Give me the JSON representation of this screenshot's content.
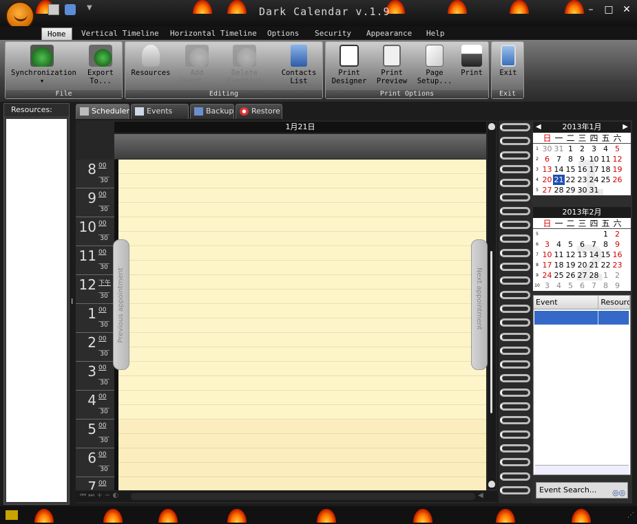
{
  "app": {
    "title": "Dark Calendar v.1.9",
    "window_buttons": {
      "minimize": "–",
      "maximize": "□",
      "close": "✕"
    }
  },
  "menu": {
    "tabs": [
      "Home",
      "Vertical Timeline",
      "Horizontal Timeline",
      "Options",
      "Security",
      "Appearance",
      "Help"
    ],
    "active": "Home"
  },
  "ribbon": {
    "groups": {
      "file": {
        "label": "File",
        "buttons": [
          {
            "label": "Synchronization",
            "icon": "sync-icon",
            "dropdown": true
          },
          {
            "label": "Export\nTo...",
            "icon": "export-icon",
            "dropdown": true
          }
        ]
      },
      "editing": {
        "label": "Editing",
        "buttons": [
          {
            "label": "Resources",
            "icon": "resources-icon"
          },
          {
            "label": "Add\nEvent...",
            "icon": "add-event-icon",
            "disabled": true
          },
          {
            "label": "Delete\nEvent(s)",
            "icon": "delete-event-icon",
            "disabled": true,
            "dropdown": true
          },
          {
            "label": "Contacts\nList",
            "icon": "contacts-icon"
          }
        ]
      },
      "print": {
        "label": "Print Options",
        "buttons": [
          {
            "label": "Print\nDesigner",
            "icon": "print-designer-icon"
          },
          {
            "label": "Print\nPreview",
            "icon": "print-preview-icon"
          },
          {
            "label": "Page\nSetup...",
            "icon": "page-setup-icon"
          },
          {
            "label": "Print",
            "icon": "printer-icon"
          }
        ]
      },
      "exit": {
        "label": "Exit",
        "buttons": [
          {
            "label": "Exit",
            "icon": "exit-door-icon"
          }
        ]
      }
    }
  },
  "resources_panel": {
    "title": "Resources:"
  },
  "main_tabs": [
    {
      "label": "Scheduler",
      "icon": "scheduler-icon",
      "active": true
    },
    {
      "label": "Events List",
      "icon": "events-list-icon"
    },
    {
      "label": "Backup",
      "icon": "backup-icon"
    },
    {
      "label": "Restore",
      "icon": "restore-icon"
    }
  ],
  "scheduler": {
    "date_header": "1月21日",
    "hours": [
      {
        "h": "8",
        "m": "00"
      },
      {
        "h": "9",
        "m": "00"
      },
      {
        "h": "10",
        "m": "00"
      },
      {
        "h": "11",
        "m": "00"
      },
      {
        "h": "12",
        "m": "下午"
      },
      {
        "h": "1",
        "m": "00"
      },
      {
        "h": "2",
        "m": "00"
      },
      {
        "h": "3",
        "m": "00"
      },
      {
        "h": "4",
        "m": "00"
      },
      {
        "h": "5",
        "m": "00"
      },
      {
        "h": "6",
        "m": "00"
      },
      {
        "h": "7",
        "m": "00"
      }
    ],
    "half": "30",
    "prev_label": "Previous appointment",
    "next_label": "Next appointment"
  },
  "calendar": {
    "weekdays": [
      "日",
      "一",
      "二",
      "三",
      "四",
      "五",
      "六"
    ],
    "months": [
      {
        "title": "2013年1月",
        "big": "1",
        "weeks": [
          {
            "wk": "1",
            "days": [
              "30",
              "31",
              "1",
              "2",
              "3",
              "4",
              "5"
            ],
            "gray": [
              0,
              1
            ]
          },
          {
            "wk": "2",
            "days": [
              "6",
              "7",
              "8",
              "9",
              "10",
              "11",
              "12"
            ],
            "gray": []
          },
          {
            "wk": "3",
            "days": [
              "13",
              "14",
              "15",
              "16",
              "17",
              "18",
              "19"
            ],
            "gray": []
          },
          {
            "wk": "4",
            "days": [
              "20",
              "21",
              "22",
              "23",
              "24",
              "25",
              "26"
            ],
            "gray": [],
            "today": 1
          },
          {
            "wk": "5",
            "days": [
              "27",
              "28",
              "29",
              "30",
              "31"
            ],
            "gray": []
          }
        ]
      },
      {
        "title": "2013年2月",
        "big": "2",
        "weeks": [
          {
            "wk": "5",
            "days": [
              "",
              "",
              "",
              "",
              "",
              "1",
              "2"
            ],
            "gray": []
          },
          {
            "wk": "6",
            "days": [
              "3",
              "4",
              "5",
              "6",
              "7",
              "8",
              "9"
            ],
            "gray": []
          },
          {
            "wk": "7",
            "days": [
              "10",
              "11",
              "12",
              "13",
              "14",
              "15",
              "16"
            ],
            "gray": []
          },
          {
            "wk": "8",
            "days": [
              "17",
              "18",
              "19",
              "20",
              "21",
              "22",
              "23"
            ],
            "gray": []
          },
          {
            "wk": "9",
            "days": [
              "24",
              "25",
              "26",
              "27",
              "28",
              "1",
              "2"
            ],
            "gray": [
              5,
              6
            ]
          },
          {
            "wk": "10",
            "days": [
              "3",
              "4",
              "5",
              "6",
              "7",
              "8",
              "9"
            ],
            "gray": [
              0,
              1,
              2,
              3,
              4,
              5,
              6
            ]
          }
        ]
      }
    ]
  },
  "event_list": {
    "columns": [
      "Event",
      "Resource"
    ],
    "search_label": "Event Search..."
  },
  "colors": {
    "accent": "#1f4fb0",
    "selection": "#3569c8",
    "weekend": "#d40000",
    "schedule_bg": "#fdf5c9"
  }
}
